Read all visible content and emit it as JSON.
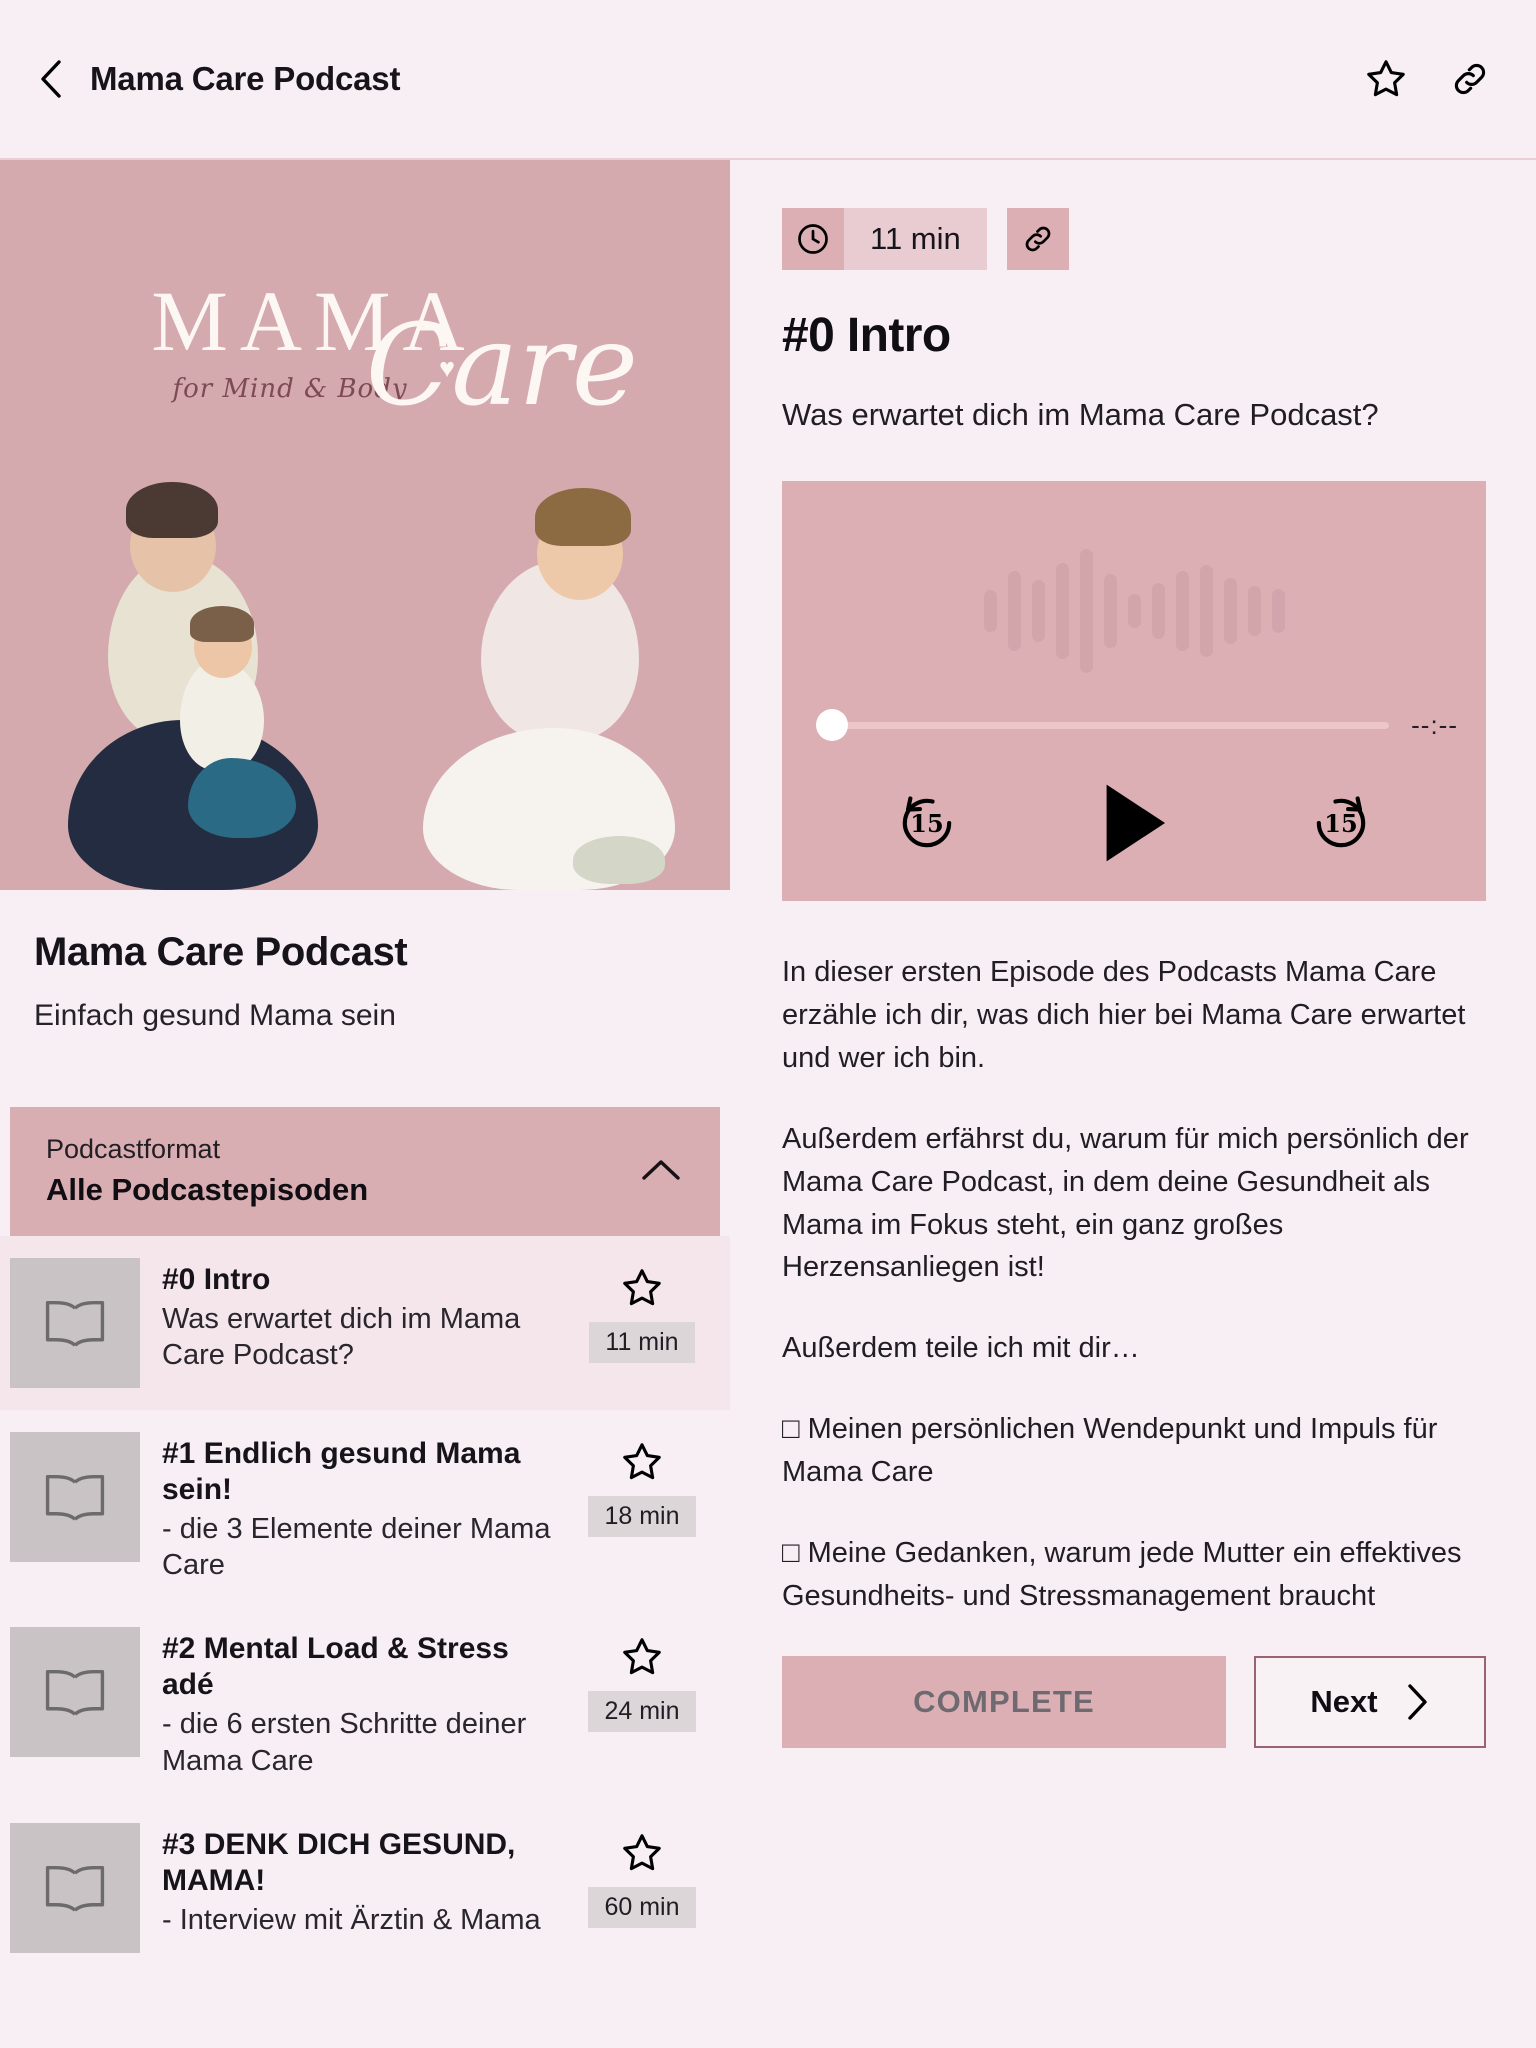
{
  "header": {
    "title": "Mama Care Podcast",
    "back_icon": "chevron-left-icon",
    "favorite_icon": "star-outline-icon",
    "link_icon": "link-icon"
  },
  "cover": {
    "logo_main": "MAMA",
    "logo_tagline": "for Mind & Body",
    "logo_script": "Care",
    "heart": "♥"
  },
  "podcast": {
    "title": "Mama Care Podcast",
    "subtitle": "Einfach gesund Mama sein"
  },
  "format_select": {
    "label": "Podcastformat",
    "value": "Alle Podcastepisoden",
    "chevron_icon": "chevron-up-icon"
  },
  "episodes": [
    {
      "title": "#0 Intro",
      "description": "Was erwartet dich im Mama Care Podcast?",
      "duration": "11 min",
      "active": true
    },
    {
      "title": "#1 Endlich gesund Mama sein!",
      "description": "- die 3 Elemente deiner Mama Care",
      "duration": "18 min",
      "active": false
    },
    {
      "title": "#2 Mental Load & Stress adé",
      "description": "- die 6 ersten Schritte deiner Mama Care",
      "duration": "24 min",
      "active": false
    },
    {
      "title": "#3 DENK DICH GESUND, MAMA!",
      "description": "- Interview mit Ärztin & Mama",
      "duration": "60 min",
      "active": false
    }
  ],
  "detail": {
    "duration": "11 min",
    "clock_icon": "clock-icon",
    "link_icon": "link-icon",
    "heading": "#0 Intro",
    "subheading": "Was erwartet dich im Mama Care Podcast?",
    "player": {
      "elapsed_time": "--:--",
      "rewind_label": "15",
      "forward_label": "15",
      "play_icon": "play-icon",
      "rewind_icon": "rewind-15-icon",
      "forward_icon": "forward-15-icon",
      "progress_percent": 0
    },
    "paragraphs": [
      "In dieser ersten Episode des Podcasts Mama Care erzähle ich dir, was dich hier bei Mama Care erwartet und wer ich bin.",
      "Außerdem erfährst du, warum für mich persönlich der Mama Care Podcast, in dem deine Gesundheit als Mama im Fokus steht, ein ganz großes Herzensanliegen ist!",
      "Außerdem teile ich mit dir…",
      "□ Meinen persönlichen Wendepunkt und Impuls für Mama Care",
      "□ Meine Gedanken, warum jede Mutter ein effektives Gesundheits- und Stressmanagement braucht"
    ],
    "complete_label": "COMPLETE",
    "next_label": "Next",
    "next_icon": "chevron-right-icon"
  },
  "colors": {
    "page_bg": "#f7eff3",
    "accent_pink": "#dcafb4",
    "accent_pink_soft": "#e8ccd1",
    "cover_bg": "#d4aaae",
    "border": "#eccfd4",
    "active_row": "#f4e6ea",
    "duration_badge": "#dcd6d9",
    "next_border": "#9b6372"
  }
}
